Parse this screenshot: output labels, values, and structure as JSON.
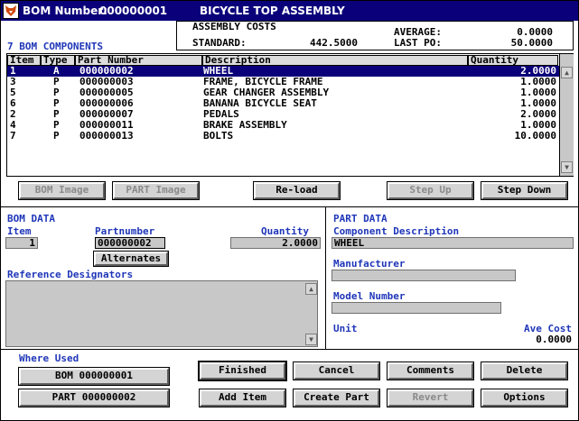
{
  "title": {
    "bom_number_label": "BOM Number:",
    "bom_number": "000000001",
    "assembly_name": "BICYCLE TOP ASSEMBLY"
  },
  "costs": {
    "header": "ASSEMBLY COSTS",
    "average_label": "AVERAGE:",
    "average": "0.0000",
    "standard_label": "STANDARD:",
    "standard": "442.5000",
    "last_po_label": "LAST PO:",
    "last_po": "50.0000"
  },
  "components_count_label": "7 BOM COMPONENTS",
  "grid": {
    "headers": [
      "Item",
      "Type",
      "Part Number",
      "Description",
      "Quantity"
    ],
    "rows": [
      {
        "item": "1",
        "type": "A",
        "part": "000000002",
        "desc": "WHEEL",
        "qty": "2.0000",
        "selected": true
      },
      {
        "item": "3",
        "type": "P",
        "part": "000000003",
        "desc": "FRAME, BICYCLE FRAME",
        "qty": "1.0000"
      },
      {
        "item": "5",
        "type": "P",
        "part": "000000005",
        "desc": "GEAR CHANGER ASSEMBLY",
        "qty": "1.0000"
      },
      {
        "item": "6",
        "type": "P",
        "part": "000000006",
        "desc": "BANANA BICYCLE SEAT",
        "qty": "1.0000"
      },
      {
        "item": "2",
        "type": "P",
        "part": "000000007",
        "desc": "PEDALS",
        "qty": "2.0000"
      },
      {
        "item": "4",
        "type": "P",
        "part": "000000011",
        "desc": "BRAKE ASSEMBLY",
        "qty": "1.0000"
      },
      {
        "item": "7",
        "type": "P",
        "part": "000000013",
        "desc": "BOLTS",
        "qty": "10.0000"
      }
    ]
  },
  "toolbar": {
    "bom_image": "BOM Image",
    "part_image": "PART Image",
    "reload": "Re-load",
    "step_up": "Step Up",
    "step_down": "Step Down"
  },
  "bom_data": {
    "section": "BOM DATA",
    "item_label": "Item",
    "item": "1",
    "partnumber_label": "Partnumber",
    "partnumber": "000000002",
    "quantity_label": "Quantity",
    "quantity": "2.0000",
    "alternates": "Alternates",
    "ref_designators_label": "Reference Designators",
    "ref_designators": ""
  },
  "part_data": {
    "section": "PART DATA",
    "component_desc_label": "Component Description",
    "component_desc": "WHEEL",
    "manufacturer_label": "Manufacturer",
    "manufacturer": "",
    "model_label": "Model Number",
    "model": "",
    "unit_label": "Unit",
    "ave_cost_label": "Ave Cost",
    "ave_cost": "0.0000"
  },
  "where_used": {
    "label": "Where Used",
    "bom_button": "BOM  000000001",
    "part_button": "PART 000000002"
  },
  "actions": {
    "finished": "Finished",
    "cancel": "Cancel",
    "comments": "Comments",
    "delete": "Delete",
    "add_item": "Add Item",
    "create_part": "Create Part",
    "revert": "Revert",
    "options": "Options"
  },
  "colors": {
    "titlebar": "#0a007a",
    "selection": "#0a007a",
    "section_text": "#1f36b8",
    "field_bg": "#c8c8c8",
    "button_bg": "#d4d4d4"
  },
  "icons": {
    "app": "fox-app-icon",
    "scroll_up": "arrow-up-icon",
    "scroll_down": "arrow-down-icon"
  }
}
